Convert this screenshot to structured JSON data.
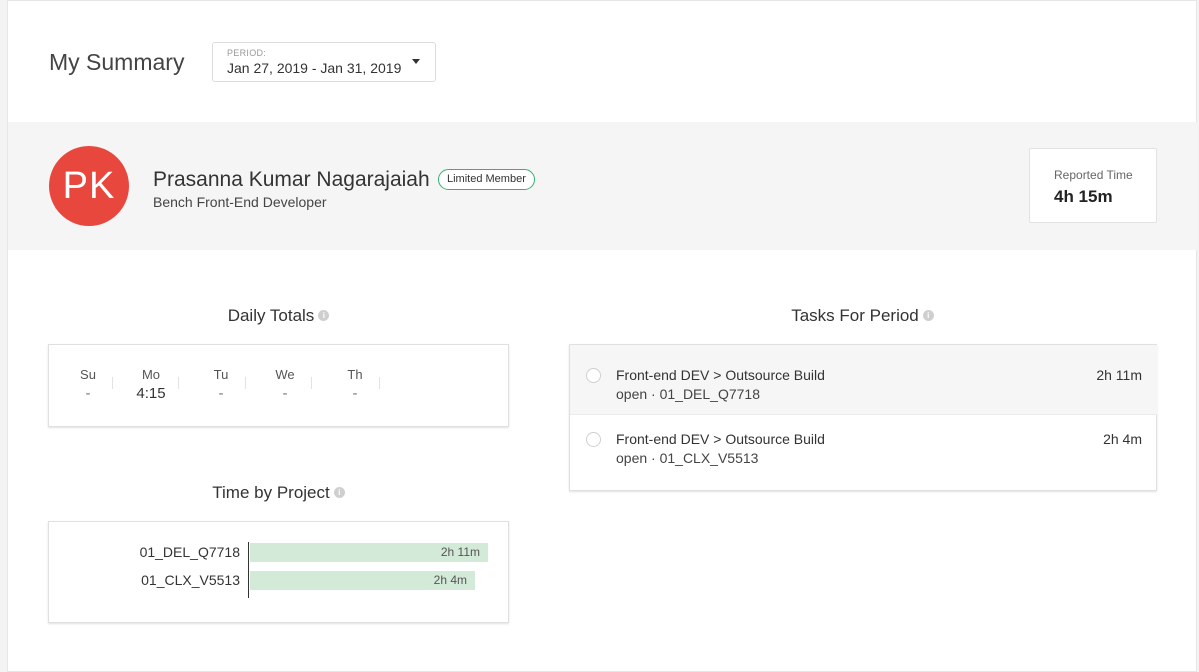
{
  "header": {
    "title": "My Summary",
    "period_label": "PERIOD:",
    "period_value": "Jan 27, 2019 - Jan 31, 2019"
  },
  "profile": {
    "initials": "PK",
    "avatar_color": "#e8473d",
    "name": "Prasanna Kumar Nagarajaiah",
    "badge": "Limited Member",
    "role": "Bench Front-End Developer",
    "reported_time_label": "Reported Time",
    "reported_time_value": "4h 15m"
  },
  "daily_totals": {
    "title": "Daily Totals",
    "days": [
      {
        "name": "Su",
        "value": "-"
      },
      {
        "name": "Mo",
        "value": "4:15"
      },
      {
        "name": "Tu",
        "value": "-"
      },
      {
        "name": "We",
        "value": "-"
      },
      {
        "name": "Th",
        "value": "-"
      }
    ]
  },
  "time_by_project": {
    "title": "Time by Project",
    "projects": [
      {
        "name": "01_DEL_Q7718",
        "time": "2h 11m",
        "minutes": 131
      },
      {
        "name": "01_CLX_V5513",
        "time": "2h 4m",
        "minutes": 124
      }
    ],
    "bar_color": "#d3ead8"
  },
  "tasks": {
    "title": "Tasks For Period",
    "items": [
      {
        "title": "Front-end DEV > Outsource Build",
        "sub": "open · 01_DEL_Q7718",
        "time": "2h 11m"
      },
      {
        "title": "Front-end DEV > Outsource Build",
        "sub": "open · 01_CLX_V5513",
        "time": "2h 4m"
      }
    ]
  },
  "info_icon": "info-icon"
}
